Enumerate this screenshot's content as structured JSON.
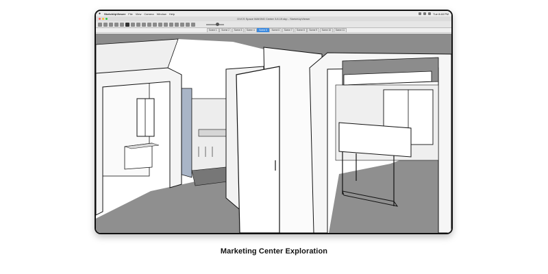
{
  "menubar": {
    "app_name": "SketchUpViewer",
    "menus": [
      "File",
      "View",
      "Camera",
      "Window",
      "Help"
    ],
    "clock": "Tue 8:48 PM"
  },
  "window": {
    "title": "DVCS Space MAKING Center 3.8.19.skp - SketchUpViewer"
  },
  "scenes": {
    "tabs": [
      "Scene 1",
      "Scene 2",
      "Scene 3",
      "Scene 4",
      "Scene 5",
      "Scene 6",
      "Scene 7",
      "Scene 8",
      "Scene 9",
      "Scene 10",
      "Scene 11"
    ],
    "active_index": 4
  },
  "caption": "Marketing Center Exploration",
  "colors": {
    "window_blue": "#a9b5c7",
    "floor_gray": "#8f8f8f",
    "ceiling_gray": "#8c8c8c",
    "scene_active": "#3d8be0"
  }
}
